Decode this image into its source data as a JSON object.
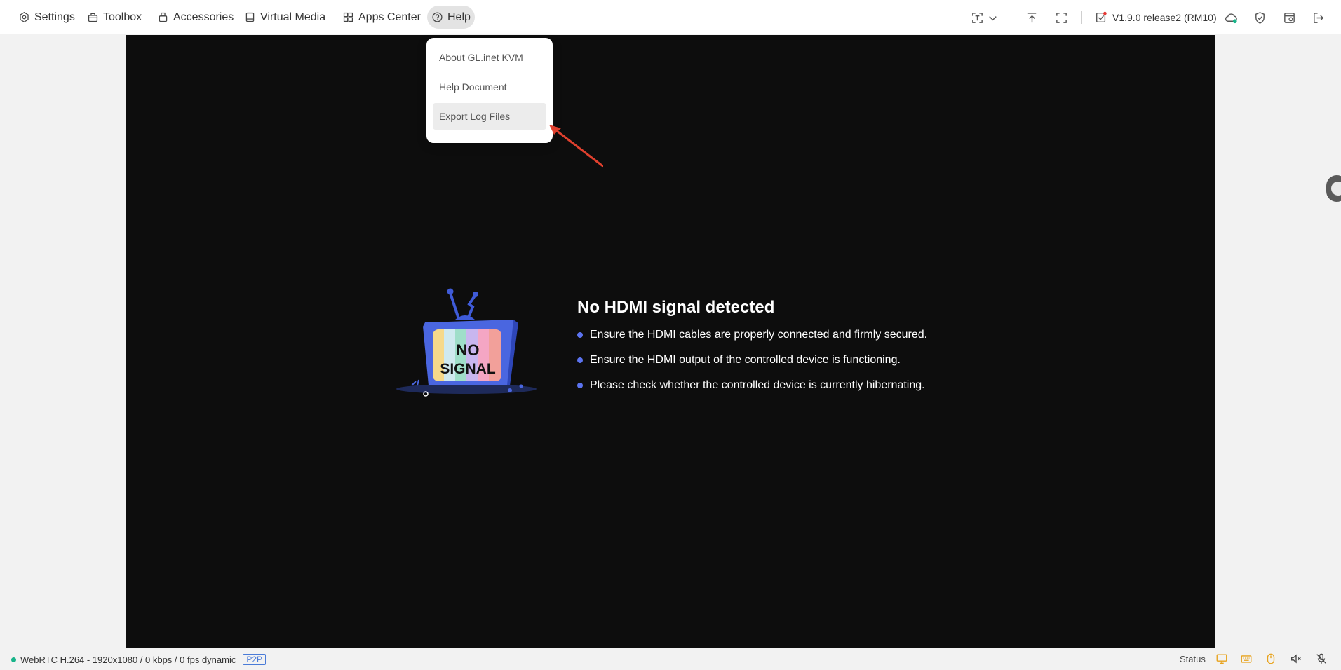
{
  "nav": {
    "items": [
      {
        "label": "Settings",
        "icon": "settings-icon"
      },
      {
        "label": "Toolbox",
        "icon": "toolbox-icon"
      },
      {
        "label": "Accessories",
        "icon": "accessories-icon"
      },
      {
        "label": "Virtual Media",
        "icon": "virtual-media-icon"
      },
      {
        "label": "Apps Center",
        "icon": "apps-center-icon"
      },
      {
        "label": "Help",
        "icon": "help-icon",
        "active": true
      }
    ]
  },
  "toolbar": {
    "version": "V1.9.0 release2 (RM10)",
    "tools": [
      "screen-capture-icon",
      "chevron-down-icon",
      "upload-icon",
      "fullscreen-icon",
      "cloud-icon",
      "shield-icon",
      "remote-icon",
      "logout-icon"
    ]
  },
  "help_menu": {
    "items": [
      "About GL.inet KVM",
      "Help Document",
      "Export Log Files"
    ],
    "highlighted": "Export Log Files"
  },
  "no_signal": {
    "tv_text_line1": "NO",
    "tv_text_line2": "SIGNAL",
    "title": "No HDMI signal detected",
    "tips": [
      "Ensure the HDMI cables are properly connected and firmly secured.",
      "Ensure the HDMI output of the controlled device is functioning.",
      "Please check whether the controlled device is currently hibernating."
    ]
  },
  "status": {
    "stream": "WebRTC H.264 - 1920x1080 /  0 kbps / 0 fps dynamic",
    "mode": "P2P",
    "label": "Status",
    "icons": [
      "monitor-icon",
      "keyboard-icon",
      "mouse-icon",
      "speaker-muted-icon",
      "microphone-muted-icon"
    ]
  },
  "colors": {
    "accent": "#5b73f0",
    "status_dot": "#19b48a",
    "status_icons": "#e8a21b",
    "annotation_arrow": "#e0402e"
  }
}
